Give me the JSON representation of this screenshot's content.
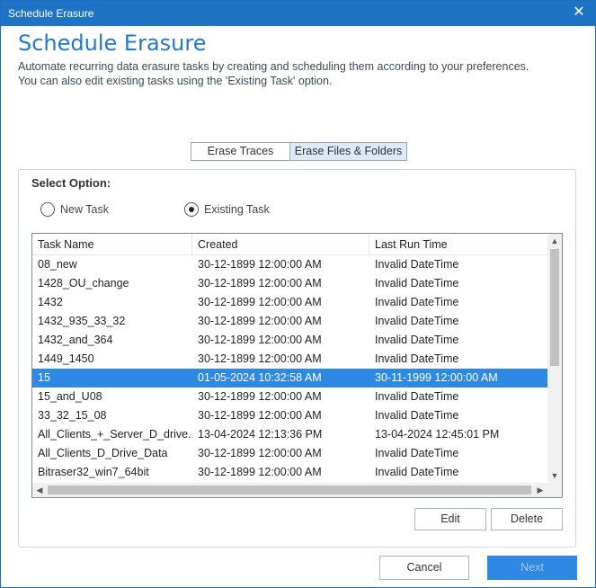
{
  "window": {
    "title": "Schedule Erasure",
    "close_glyph": "✕"
  },
  "header": {
    "heading": "Schedule Erasure",
    "description_line1": "Automate recurring data erasure tasks by creating and scheduling them according to your preferences.",
    "description_line2": "You can also edit existing tasks using the 'Existing Task' option."
  },
  "tabs": [
    {
      "label": "Erase Traces",
      "active": false
    },
    {
      "label": "Erase Files & Folders",
      "active": true
    }
  ],
  "select_option": {
    "label": "Select Option:",
    "options": [
      {
        "label": "New Task",
        "selected": false
      },
      {
        "label": "Existing Task",
        "selected": true
      }
    ]
  },
  "table": {
    "columns": [
      "Task Name",
      "Created",
      "Last Run Time"
    ],
    "rows": [
      [
        "08_new",
        "30-12-1899 12:00:00 AM",
        "Invalid DateTime"
      ],
      [
        "1428_OU_change",
        "30-12-1899 12:00:00 AM",
        "Invalid DateTime"
      ],
      [
        "1432",
        "30-12-1899 12:00:00 AM",
        "Invalid DateTime"
      ],
      [
        "1432_935_33_32",
        "30-12-1899 12:00:00 AM",
        "Invalid DateTime"
      ],
      [
        "1432_and_364",
        "30-12-1899 12:00:00 AM",
        "Invalid DateTime"
      ],
      [
        "1449_1450",
        "30-12-1899 12:00:00 AM",
        "Invalid DateTime"
      ],
      [
        "15",
        "01-05-2024 10:32:58 AM",
        "30-11-1999 12:00:00 AM"
      ],
      [
        "15_and_U08",
        "30-12-1899 12:00:00 AM",
        "Invalid DateTime"
      ],
      [
        "33_32_15_08",
        "30-12-1899 12:00:00 AM",
        "Invalid DateTime"
      ],
      [
        "All_Clients_+_Server_D_drive...",
        "13-04-2024 12:13:36 PM",
        "13-04-2024 12:45:01 PM"
      ],
      [
        "All_Clients_D_Drive_Data",
        "30-12-1899 12:00:00 AM",
        "Invalid DateTime"
      ],
      [
        "Bitraser32_win7_64bit",
        "30-12-1899 12:00:00 AM",
        "Invalid DateTime"
      ]
    ],
    "selected_row": 6,
    "scroll_up_glyph": "▲",
    "scroll_down_glyph": "▼",
    "scroll_left_glyph": "◀",
    "scroll_right_glyph": "▶"
  },
  "actions": {
    "edit": "Edit",
    "delete": "Delete"
  },
  "footer": {
    "cancel": "Cancel",
    "next": "Next"
  },
  "colors": {
    "accent": "#1f73c4",
    "selection": "#2f88e4",
    "heading": "#1f78d1"
  }
}
